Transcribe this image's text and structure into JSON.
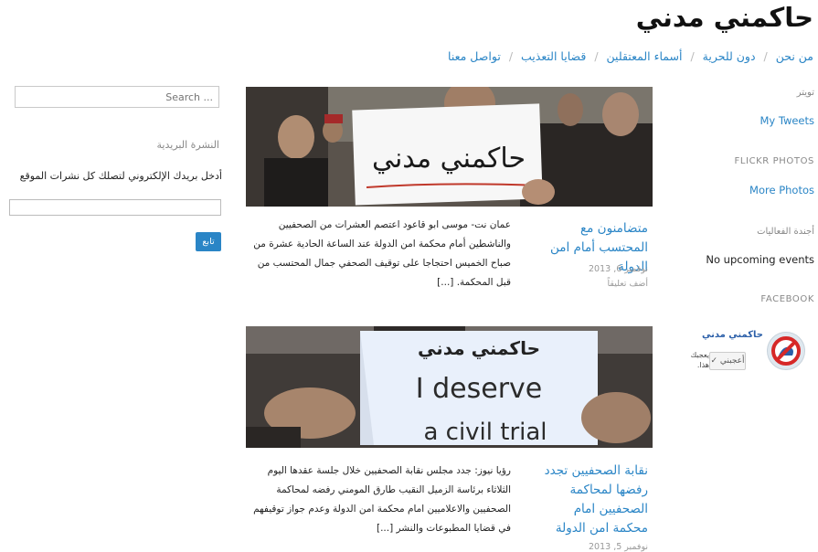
{
  "header": {
    "site_title": "حاكمني مدني",
    "nav": [
      {
        "label": "من نحن"
      },
      {
        "label": "دون للحرية"
      },
      {
        "label": "أسماء المعتقلين"
      },
      {
        "label": "قضايا التعذيب"
      },
      {
        "label": "تواصل معنا"
      }
    ],
    "nav_separator": "/"
  },
  "sidebar_right": {
    "twitter_label": "تويتر",
    "my_tweets": "My Tweets",
    "flickr_label": "FLICKR PHOTOS",
    "more_photos": "More Photos",
    "events_label": "أجندة الفعاليات",
    "no_events": "No upcoming events",
    "facebook_label": "FACEBOOK",
    "facebook": {
      "page_name": "حاكمني مدني",
      "like_button": "✓ أعجبني",
      "side_text": "يعجبك هذا."
    }
  },
  "posts": [
    {
      "title": "متضامنون مع المحتسب أمام امن الدولة",
      "date": "نوفمبر 6, 2013",
      "comments": "أضف تعليقاً",
      "excerpt": "عمان نت- موسى ابو قاعود  اعتصم العشرات من الصحفيين والناشطين أمام محكمة امن الدولة عند الساعة الحادية عشرة من صباح الخميس احتجاجا على توقيف الصحفي جمال المحتسب من قبل المحكمة. [...]",
      "image_sign_text": "حاكمني مدني"
    },
    {
      "title": "نقابة الصحفيين تجدد رفضها لمحاكمة الصحفيين امام محكمة امن الدولة",
      "date": "نوفمبر 5, 2013",
      "excerpt": "رؤيا نيوز:  جدد مجلس نقابة الصحفيين خلال جلسة عقدها اليوم الثلاثاء برئاسة الزميل النقيب طارق المومني رفضه لمحاكمة الصحفيين والاعلاميين امام محكمة امن الدولة وعدم جواز توقيفهم في قضايا المطبوعات والنشر [...]",
      "image_sign_text": {
        "arabic": "حاكمني مدني",
        "line1": "I deserve",
        "line2": "a civil trial"
      }
    }
  ],
  "sidebar_left": {
    "search_placeholder": "Search ...",
    "newsletter_label": "النشرة البريدية",
    "newsletter_desc": "أدخل بريدك الإلكتروني لتصلك كل نشرات الموقع",
    "newsletter_button": "تابع"
  },
  "colors": {
    "link": "#2a85c6",
    "button": "#2a85c6"
  }
}
